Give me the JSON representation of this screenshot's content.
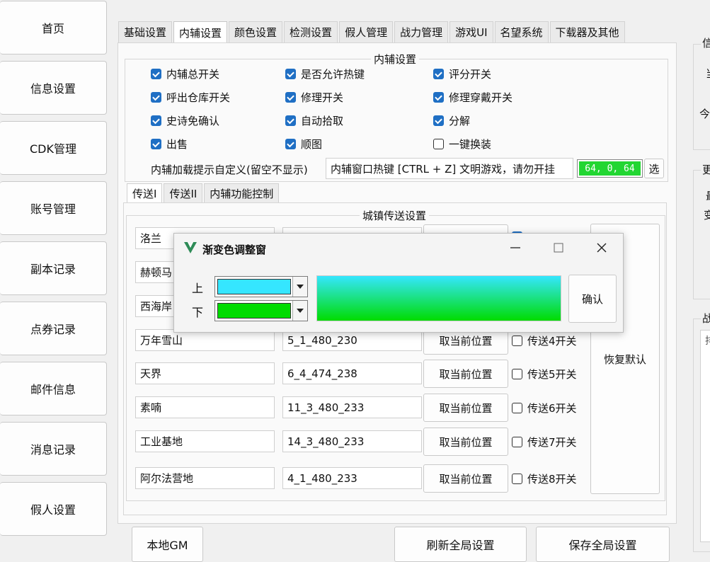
{
  "nav": [
    "首页",
    "信息设置",
    "CDK管理",
    "账号管理",
    "副本记录",
    "点券记录",
    "邮件信息",
    "消息记录",
    "假人设置"
  ],
  "tabs": [
    "基础设置",
    "内辅设置",
    "颜色设置",
    "检测设置",
    "假人管理",
    "战力管理",
    "游戏UI",
    "名望系统",
    "下载器及其他"
  ],
  "active_tab": 1,
  "assist_group": {
    "title": "内辅设置",
    "checks": [
      {
        "label": "内辅总开关",
        "checked": true
      },
      {
        "label": "是否允许热键",
        "checked": true
      },
      {
        "label": "评分开关",
        "checked": true
      },
      {
        "label": "呼出仓库开关",
        "checked": true
      },
      {
        "label": "修理开关",
        "checked": true
      },
      {
        "label": "修理穿戴开关",
        "checked": true
      },
      {
        "label": "史诗免确认",
        "checked": true
      },
      {
        "label": "自动拾取",
        "checked": true
      },
      {
        "label": "分解",
        "checked": true
      },
      {
        "label": "出售",
        "checked": true
      },
      {
        "label": "顺图",
        "checked": true
      },
      {
        "label": "一键换装",
        "checked": false
      }
    ],
    "prompt_label": "内辅加载提示自定义(留空不显示)",
    "prompt_value": "内辅窗口热键 [CTRL + Z] 文明游戏，请勿开挂",
    "color_value": "64, 0, 64",
    "color_bg": "#22d632",
    "select_button": "选"
  },
  "subtabs": [
    "传送I",
    "传送II",
    "内辅功能控制"
  ],
  "teleport": {
    "title": "城镇传送设置",
    "rows": [
      {
        "name": "洛兰",
        "coord": "",
        "button": "",
        "toggle": ""
      },
      {
        "name": "赫顿马",
        "coord": "",
        "button": "",
        "toggle": ""
      },
      {
        "name": "西海岸",
        "coord": "",
        "button": "",
        "toggle": ""
      },
      {
        "name": "万年雪山",
        "coord": "5_1_480_230",
        "button": "取当前位置",
        "toggle": "传送4开关"
      },
      {
        "name": "天界",
        "coord": "6_4_474_238",
        "button": "取当前位置",
        "toggle": "传送5开关"
      },
      {
        "name": "素喃",
        "coord": "11_3_480_233",
        "button": "取当前位置",
        "toggle": "传送6开关"
      },
      {
        "name": "工业基地",
        "coord": "14_3_480_233",
        "button": "取当前位置",
        "toggle": "传送7开关"
      },
      {
        "name": "阿尔法营地",
        "coord": "4_1_480_233",
        "button": "取当前位置",
        "toggle": "传送8开关"
      }
    ],
    "restore_button": "恢复默认"
  },
  "popup": {
    "title": "渐变色调整窗",
    "top_label": "上",
    "bottom_label": "下",
    "top_color": "#35e6ff",
    "bottom_color": "#00dc00",
    "confirm": "确认"
  },
  "bottom_buttons": {
    "gm": "本地GM",
    "refresh": "刷新全局设置",
    "save": "保存全局设置"
  },
  "right_fragments": {
    "g1_title": "信",
    "g1_a": "当",
    "g1_b": "今",
    "g2_title": "更",
    "g2_a": "最",
    "g2_b": "变",
    "g3_title": "战",
    "g3_a": "排"
  }
}
